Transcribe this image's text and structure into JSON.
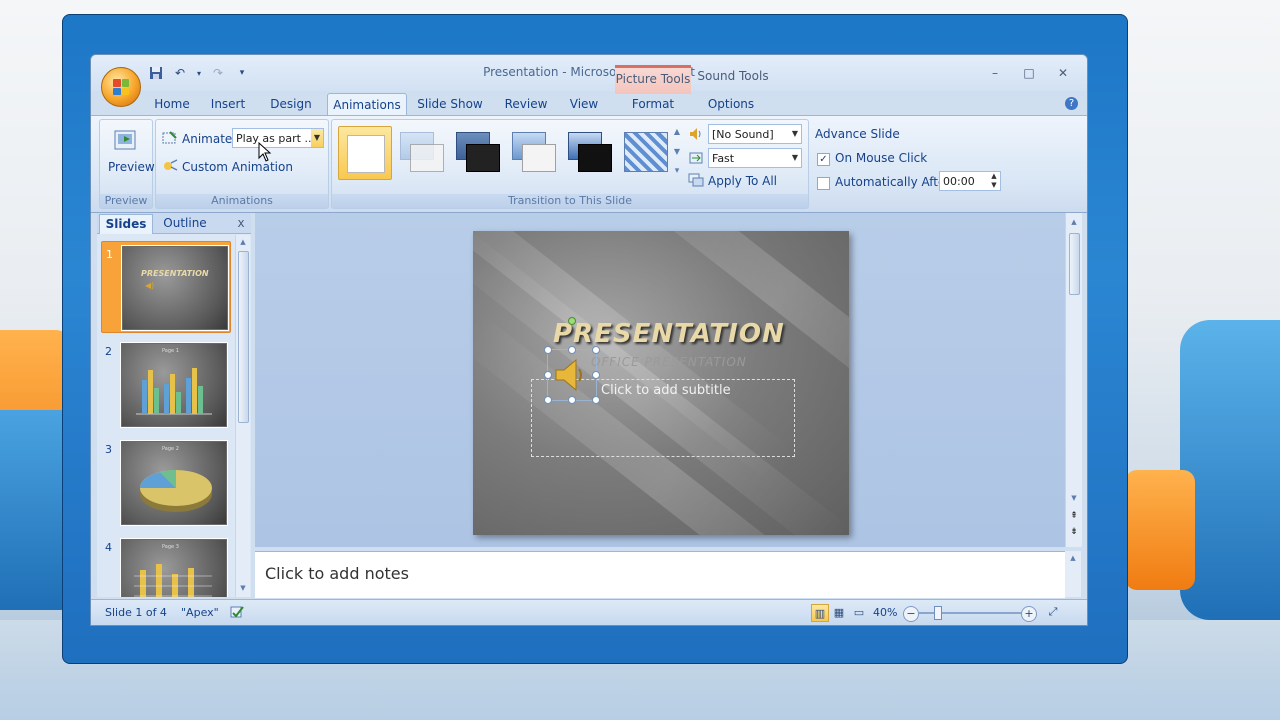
{
  "window": {
    "title": "Presentation - Microsoft PowerPoint",
    "contextual_tabs": [
      "Picture Tools",
      "Sound Tools"
    ],
    "minimize": "–",
    "maximize": "□",
    "close": "✕"
  },
  "tabs": [
    "Home",
    "Insert",
    "Design",
    "Animations",
    "Slide Show",
    "Review",
    "View",
    "Format",
    "Options"
  ],
  "active_tab": "Animations",
  "ribbon": {
    "preview_group": {
      "button_label": "Preview",
      "group_label": "Preview"
    },
    "animations_group": {
      "animate_label": "Animate:",
      "animate_value": "Play as part ...",
      "custom_animation_label": "Custom Animation",
      "group_label": "Animations"
    },
    "transition_group": {
      "sound_value": "[No Sound]",
      "speed_value": "Fast",
      "apply_to_all_label": "Apply To All",
      "group_label": "Transition to This Slide"
    },
    "advance_group": {
      "title": "Advance Slide",
      "on_mouse_click_label": "On Mouse Click",
      "on_mouse_click_checked": true,
      "automatically_after_label": "Automatically After:",
      "automatically_after_checked": false,
      "time_value": "00:00"
    }
  },
  "left_pane": {
    "tabs": [
      "Slides",
      "Outline"
    ],
    "close": "x",
    "slides": [
      {
        "number": "1",
        "thumb_title": "PRESENTATION"
      },
      {
        "number": "2",
        "thumb_title": "Page 1"
      },
      {
        "number": "3",
        "thumb_title": "Page 2"
      },
      {
        "number": "4",
        "thumb_title": "Page 3"
      }
    ]
  },
  "slide": {
    "title": "PRESENTATION",
    "subtitle_art": "OFFICE PRESENTATION",
    "subtitle_placeholder": "Click to add subtitle"
  },
  "notes": {
    "placeholder": "Click to add notes"
  },
  "status_bar": {
    "slide_counter": "Slide 1 of 4",
    "theme": "\"Apex\"",
    "zoom": "40%"
  },
  "colors": {
    "accent_orange": "#f7a33a",
    "ribbon_blue": "#15428b",
    "frame_blue": "#2b86d2"
  }
}
